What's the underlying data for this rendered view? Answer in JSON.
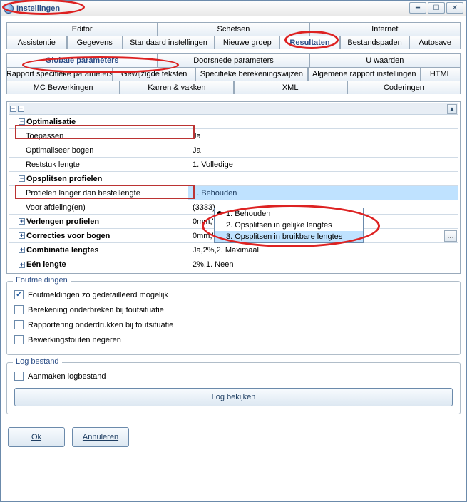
{
  "window": {
    "title": "Instellingen"
  },
  "topTabs": [
    [
      "Editor",
      "Schetsen",
      "Internet"
    ]
  ],
  "subTabs": [
    "Assistentie",
    "Gegevens",
    "Standaard instellingen",
    "Nieuwe groep",
    "Resultaten",
    "Bestandspaden",
    "Autosave"
  ],
  "paramTabs1": [
    "Globale parameters",
    "Doorsnede parameters",
    "U waarden"
  ],
  "paramTabs2": [
    "Rapport specifieke parameters",
    "Gewijzigde teksten",
    "Specifieke berekeningswijzen",
    "Algemene rapport instellingen",
    "HTML"
  ],
  "paramTabs3": [
    "MC Bewerkingen",
    "Karren & vakken",
    "XML",
    "Coderingen"
  ],
  "tree": {
    "optimalisatie": {
      "label": "Optimalisatie",
      "rows": {
        "toepassen": {
          "label": "Toepassen",
          "value": "Ja"
        },
        "optimaliseerBogen": {
          "label": "Optimaliseer bogen",
          "value": "Ja"
        },
        "reststuk": {
          "label": "Reststuk lengte",
          "value": "1. Volledige"
        }
      }
    },
    "opsplitsen": {
      "label": "Opsplitsen profielen",
      "rows": {
        "langer": {
          "label": "Profielen langer dan bestellengte",
          "value": "1. Behouden"
        },
        "afdeling": {
          "label": "Voor afdeling(en)",
          "value": "(3333)"
        }
      }
    },
    "verlengen": {
      "label": "Verlengen profielen",
      "value": "0mm,\"()\""
    },
    "correcties": {
      "label": "Correcties voor bogen",
      "value": "0mm,\"()\""
    },
    "combinatie": {
      "label": "Combinatie lengtes",
      "value": "Ja,2%,2. Maximaal"
    },
    "eenlengte": {
      "label": "Eén lengte",
      "value": "2%,1. Neen"
    }
  },
  "dropdown": {
    "items": [
      "1. Behouden",
      "2. Opsplitsen in gelijke lengtes",
      "3. Opsplitsen in bruikbare lengtes"
    ]
  },
  "errors": {
    "group": "Foutmeldingen",
    "detailed": "Foutmeldingen zo gedetailleerd mogelijk",
    "interrupt": "Berekening onderbreken bij foutsituatie",
    "suppress": "Rapportering onderdrukken bij foutsituatie",
    "ignore": "Bewerkingsfouten negeren"
  },
  "log": {
    "group": "Log bestand",
    "create": "Aanmaken logbestand",
    "view": "Log bekijken"
  },
  "buttons": {
    "ok": "Ok",
    "cancel": "Annuleren"
  }
}
